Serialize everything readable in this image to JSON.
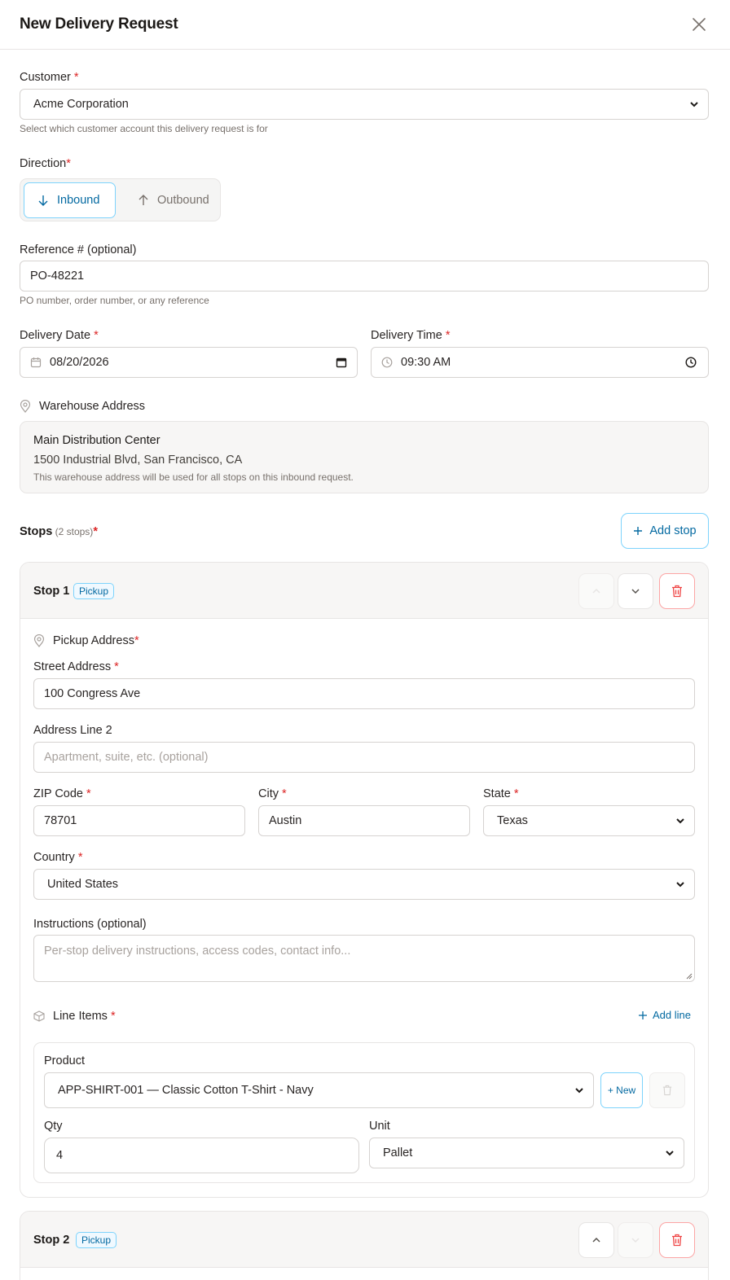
{
  "header": {
    "title": "New Delivery Request"
  },
  "customer": {
    "label": "Customer",
    "value": "Acme Corporation",
    "help": "Select which customer account this delivery request is for"
  },
  "direction": {
    "label": "Direction",
    "inbound": "Inbound",
    "outbound": "Outbound",
    "selected": "Inbound"
  },
  "reference": {
    "label": "Reference # (optional)",
    "value": "PO-48221",
    "help": "PO number, order number, or any reference"
  },
  "delivery_date": {
    "label": "Delivery Date",
    "value": "08/20/2026"
  },
  "delivery_time": {
    "label": "Delivery Time",
    "value": "09:30 AM"
  },
  "warehouse": {
    "label": "Warehouse Address",
    "name": "Main Distribution Center",
    "address": "1500 Industrial Blvd, San Francisco, CA",
    "note": "This warehouse address will be used for all stops on this inbound request."
  },
  "stops": {
    "label": "Stops",
    "count_text": "(2 stops)",
    "add_label": "Add stop",
    "items": [
      {
        "title": "Stop 1",
        "badge": "Pickup",
        "pickup_label": "Pickup Address",
        "street_label": "Street Address",
        "street_value": "100 Congress Ave",
        "line2_label": "Address Line 2",
        "line2_placeholder": "Apartment, suite, etc. (optional)",
        "zip_label": "ZIP Code",
        "zip_value": "78701",
        "city_label": "City",
        "city_value": "Austin",
        "state_label": "State",
        "state_value": "Texas",
        "country_label": "Country",
        "country_value": "United States",
        "instructions_label": "Instructions (optional)",
        "instructions_placeholder": "Per-stop delivery instructions, access codes, contact info...",
        "line_items_label": "Line Items",
        "add_line_label": "Add line",
        "line_items": [
          {
            "product_label": "Product",
            "product_value": "APP-SHIRT-001 — Classic Cotton T-Shirt - Navy",
            "new_label": "+ New",
            "qty_label": "Qty",
            "qty_value": "4",
            "unit_label": "Unit",
            "unit_value": "Pallet"
          }
        ]
      },
      {
        "title": "Stop 2",
        "badge": "Pickup"
      }
    ]
  },
  "colors": {
    "accent": "#0369a1",
    "accent_border": "#7dd3fc",
    "required": "#dc2626",
    "danger": "#ef4444"
  }
}
